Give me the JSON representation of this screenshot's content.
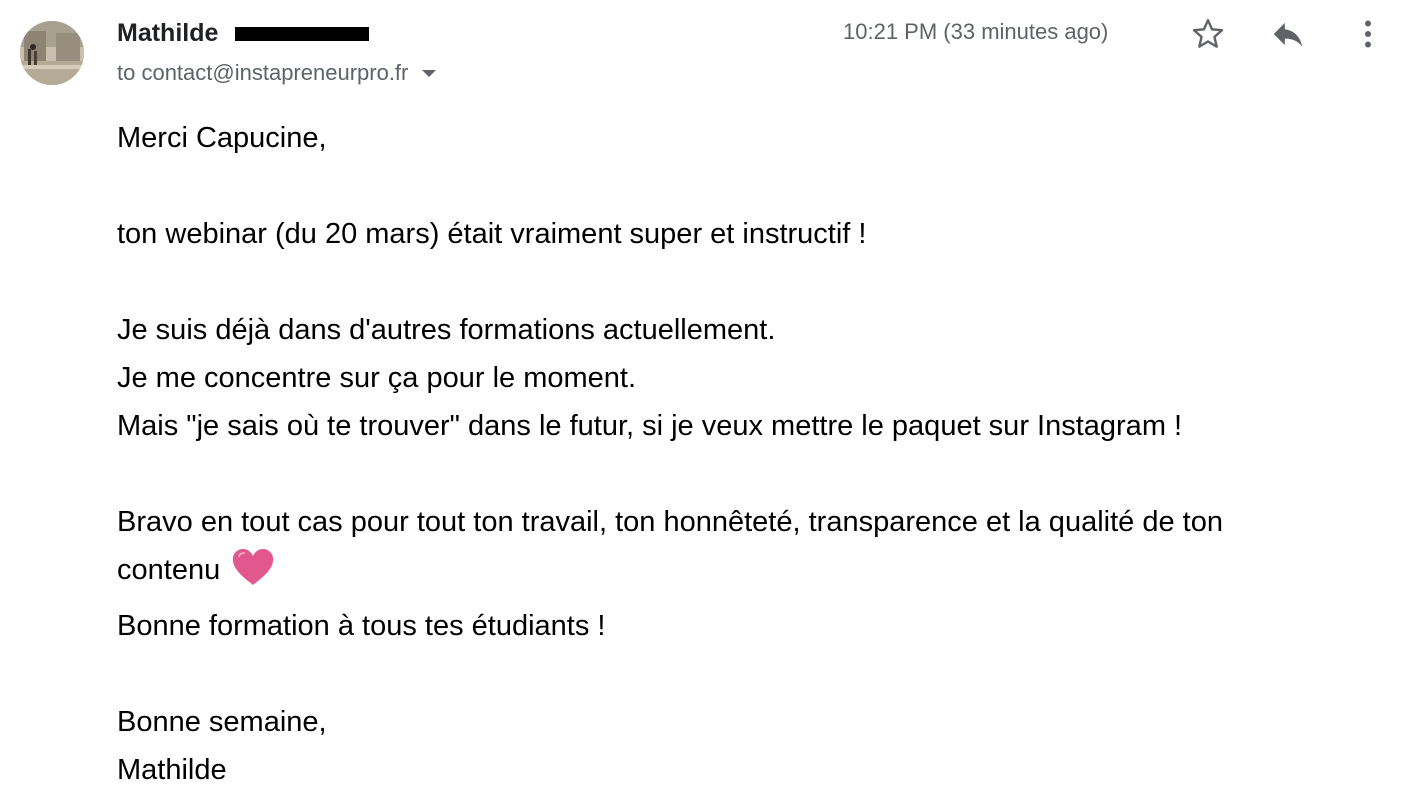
{
  "header": {
    "sender_name": "Mathilde",
    "recipient_line": "to contact@instapreneurpro.fr",
    "timestamp": "10:21 PM (33 minutes ago)"
  },
  "icons": {
    "star": "star-outline-icon",
    "reply": "reply-icon",
    "more": "more-vert-icon",
    "recipient_dropdown": "caret-down-icon",
    "emoji": "heart-emoji"
  },
  "colors": {
    "secondary_text": "#5f6368",
    "heart": "#e3578f",
    "redaction": "#000000"
  },
  "body": {
    "greeting": "Merci Capucine,",
    "line1": "ton webinar (du 20 mars) était vraiment super et instructif !",
    "line2": "Je suis déjà dans d'autres formations actuellement.",
    "line3": "Je me concentre sur ça pour le moment.",
    "line4": "Mais \"je sais où te trouver\" dans le futur, si je veux mettre le paquet sur Instagram !",
    "line5": "Bravo en tout cas pour tout ton travail, ton honnêteté, transparence et la qualité de ton",
    "line6": "contenu",
    "line7": "Bonne formation à tous tes étudiants !",
    "closing": "Bonne semaine,",
    "signature": "Mathilde"
  }
}
